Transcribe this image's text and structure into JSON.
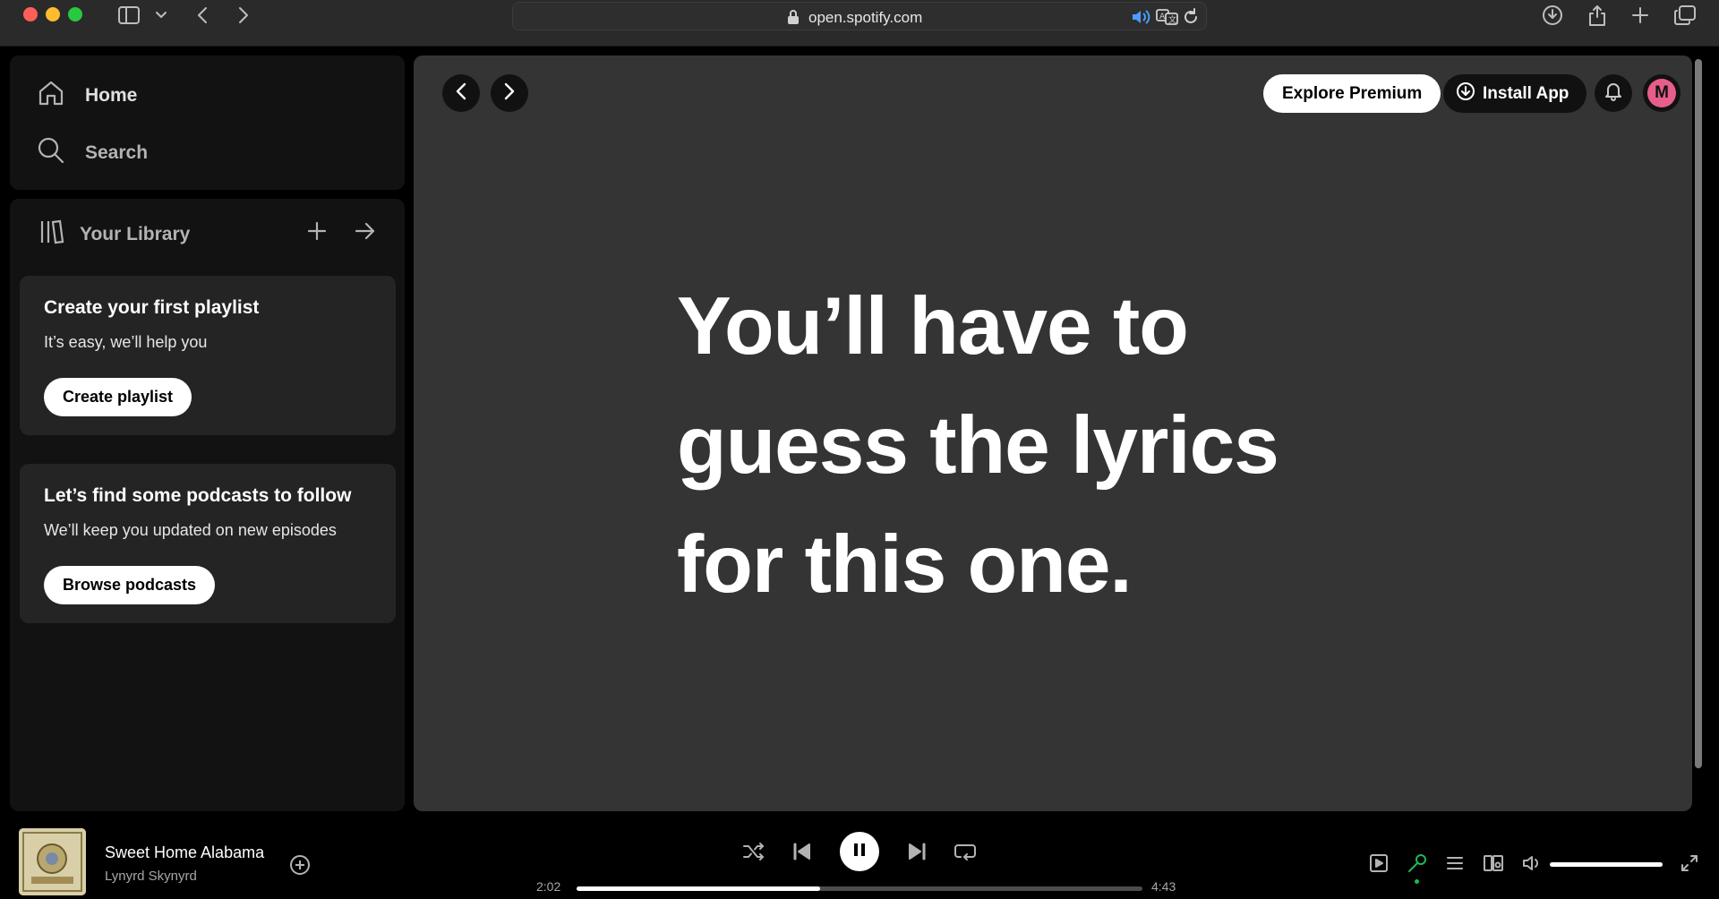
{
  "browser": {
    "url": "open.spotify.com"
  },
  "sidebar": {
    "nav": [
      {
        "label": "Home",
        "icon": "home-icon"
      },
      {
        "label": "Search",
        "icon": "search-icon"
      }
    ],
    "library": {
      "title": "Your Library",
      "cards": [
        {
          "title": "Create your first playlist",
          "subtitle": "It’s easy, we’ll help you",
          "button": "Create playlist"
        },
        {
          "title": "Let’s find some podcasts to follow",
          "subtitle": "We’ll keep you updated on new episodes",
          "button": "Browse podcasts"
        }
      ]
    }
  },
  "header": {
    "explore_premium": "Explore Premium",
    "install_app": "Install App",
    "avatar_initial": "M"
  },
  "main": {
    "lyrics_message": "You’ll have to\nguess the lyrics\nfor this one."
  },
  "player": {
    "track_title": "Sweet Home Alabama",
    "track_artist": "Lynyrd Skynyrd",
    "elapsed": "2:02",
    "duration": "4:43",
    "progress_fraction": 0.43,
    "volume_fraction": 1.0,
    "state": "playing"
  },
  "colors": {
    "accent_green": "#1db954",
    "avatar_bg": "#e75e8a",
    "main_bg": "#343434"
  }
}
